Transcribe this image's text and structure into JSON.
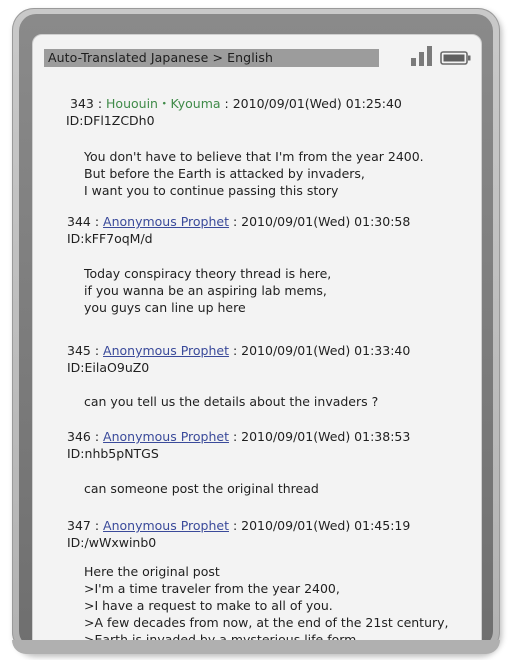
{
  "status_bar": {
    "label": "Auto-Translated  Japanese > English"
  },
  "icons": {
    "signal": "signal-strength-icon",
    "battery": "battery-icon"
  },
  "posts": [
    {
      "number": "343",
      "sep": " : ",
      "name": "Hououin・Kyouma",
      "date": " : 2010/09/01(Wed) 01:25:40",
      "id": "ID:DFl1ZCDh0",
      "lines": [
        "You don't have to believe that I'm from the year 2400.",
        "But before the Earth is attacked by invaders,",
        "I want you to continue passing this story"
      ]
    },
    {
      "number": "344",
      "sep": " : ",
      "name": "Anonymous Prophet",
      "date": " : 2010/09/01(Wed) 01:30:58",
      "id": "ID:kFF7oqM/d",
      "lines": [
        "Today conspiracy theory thread is here,",
        "if you wanna be an aspiring lab mems,",
        "you  guys can line up here"
      ]
    },
    {
      "number": "345",
      "sep": " : ",
      "name": "Anonymous Prophet",
      "date": " : 2010/09/01(Wed) 01:33:40",
      "id": "ID:EilaO9uZ0",
      "lines": [
        "can you tell us the details about the invaders ?"
      ]
    },
    {
      "number": "346",
      "sep": " : ",
      "name": "Anonymous Prophet",
      "date": " : 2010/09/01(Wed) 01:38:53",
      "id": "ID:nhb5pNTGS",
      "lines": [
        "can someone post the original thread"
      ]
    },
    {
      "number": "347",
      "sep": " : ",
      "name": "Anonymous Prophet",
      "date": " : 2010/09/01(Wed) 01:45:19",
      "id": "ID:/wWxwinb0",
      "lines": [
        "Here the original post",
        ">I'm a time traveler from the year 2400,",
        ">I have a request to make to all of you.",
        ">A few decades from now, at the end of the 21st century,",
        ">Earth is invaded by a mysterious life form"
      ]
    }
  ]
}
